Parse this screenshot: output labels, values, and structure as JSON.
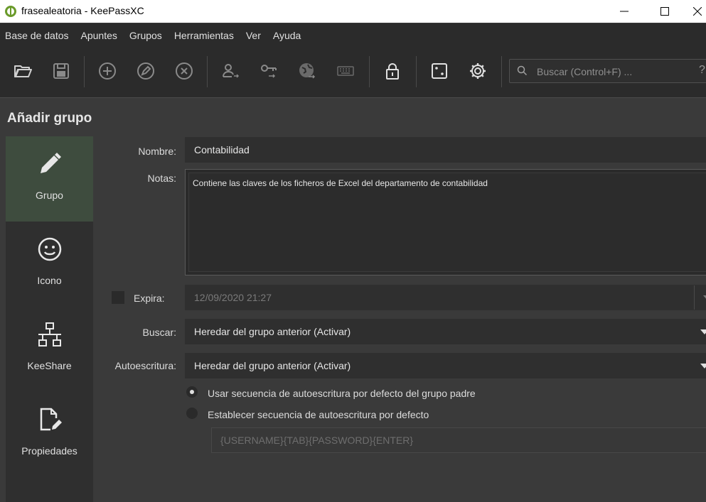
{
  "window": {
    "title": "frasealeatoria - KeePassXC"
  },
  "menu": [
    "Base de datos",
    "Apuntes",
    "Grupos",
    "Herramientas",
    "Ver",
    "Ayuda"
  ],
  "toolbar": {
    "search_placeholder": "Buscar (Control+F) ...",
    "help_label": "?"
  },
  "page": {
    "heading": "Añadir grupo"
  },
  "sidebar": {
    "items": [
      {
        "label": "Grupo",
        "icon": "pencil-icon",
        "active": true
      },
      {
        "label": "Icono",
        "icon": "smiley-icon",
        "active": false
      },
      {
        "label": "KeeShare",
        "icon": "network-icon",
        "active": false
      },
      {
        "label": "Propiedades",
        "icon": "file-edit-icon",
        "active": false
      }
    ]
  },
  "form": {
    "name_label": "Nombre:",
    "name_value": "Contabilidad",
    "notes_label": "Notas:",
    "notes_value": "Contiene las claves de los ficheros de Excel del departamento de contabilidad",
    "expires_label": "Expira:",
    "expires_checked": false,
    "expires_value": "12/09/2020 21:27",
    "search_label": "Buscar:",
    "search_value": "Heredar del grupo anterior (Activar)",
    "autotype_label": "Autoescritura:",
    "autotype_value": "Heredar del grupo anterior (Activar)",
    "radio_parent_label": "Usar secuencia  de autoescritura por defecto del grupo padre",
    "radio_custom_label": "Establecer secuencia de autoescritura por defecto",
    "sequence_placeholder": "{USERNAME}{TAB}{PASSWORD}{ENTER}"
  },
  "colors": {
    "background": "#3a3a3a",
    "toolbar": "#2b2b2b",
    "active_sidebar": "#3e4c3e"
  }
}
